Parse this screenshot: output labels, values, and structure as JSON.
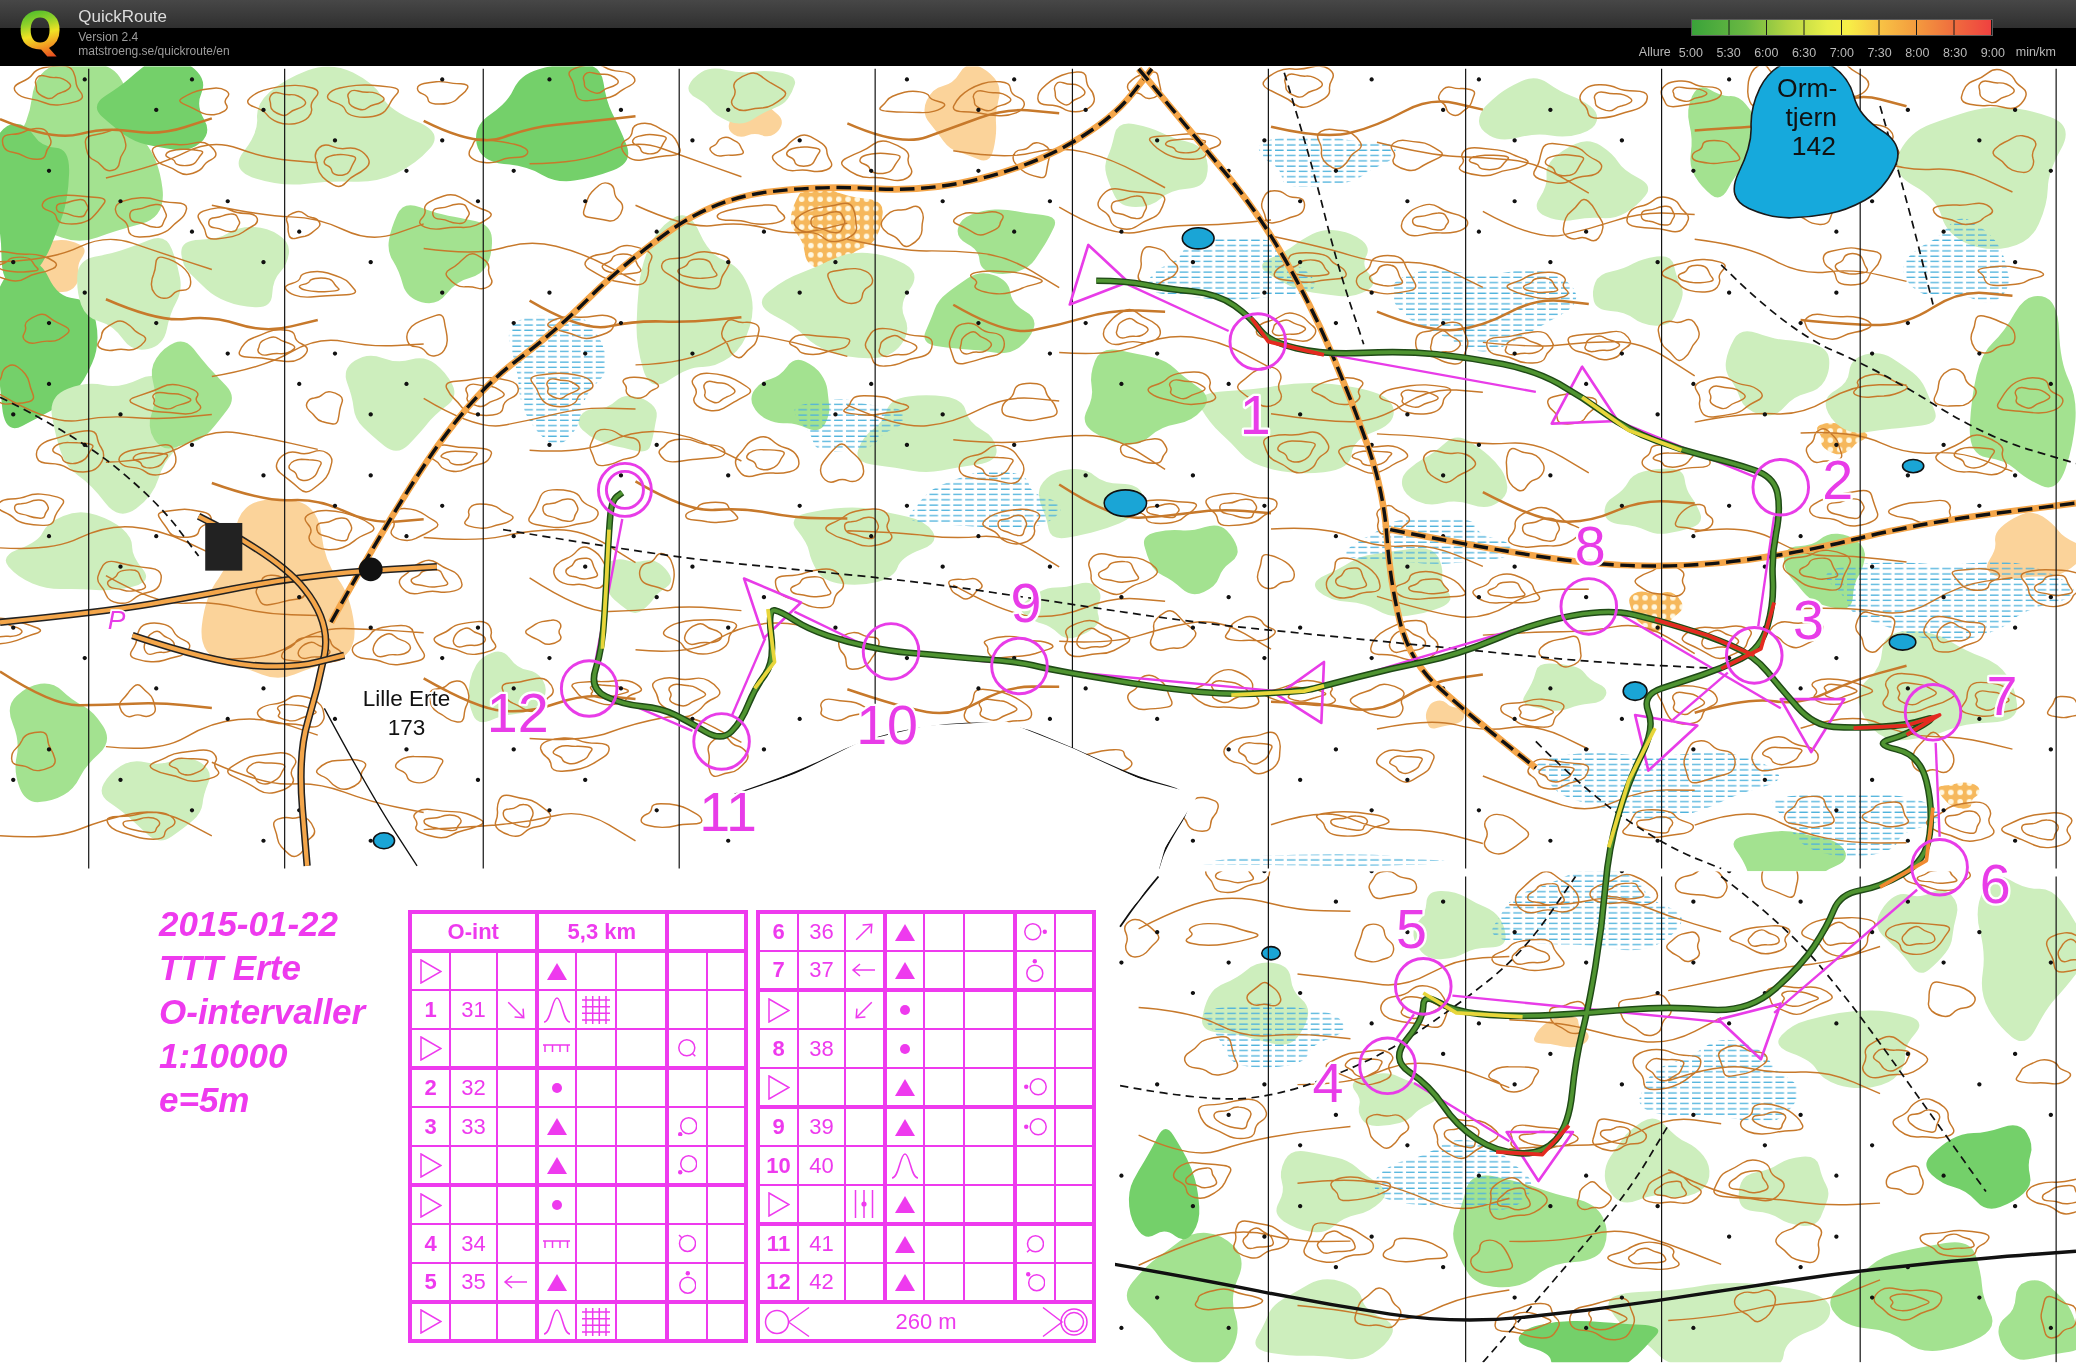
{
  "app": {
    "logo": "Q",
    "title": "QuickRoute",
    "version": "Version 2.4",
    "url": "matstroeng.se/quickroute/en"
  },
  "pace_legend": {
    "label": "Allure",
    "ticks": [
      "5:00",
      "5:30",
      "6:00",
      "6:30",
      "7:00",
      "7:30",
      "8:00",
      "8:30",
      "9:00"
    ],
    "unit": "min/km"
  },
  "map": {
    "place_names": [
      {
        "lines": [
          "Orm-",
          "tjern",
          "142"
        ]
      },
      {
        "lines": [
          "Lille Erte",
          "173"
        ]
      }
    ],
    "parking": "P",
    "controls": [
      {
        "number": "1"
      },
      {
        "number": "2"
      },
      {
        "number": "3"
      },
      {
        "number": "4"
      },
      {
        "number": "5"
      },
      {
        "number": "6"
      },
      {
        "number": "7"
      },
      {
        "number": "8"
      },
      {
        "number": "9"
      },
      {
        "number": "10"
      },
      {
        "number": "11"
      },
      {
        "number": "12"
      }
    ]
  },
  "map_notes": {
    "lines": [
      "2015-01-22",
      "TTT Erte",
      "O-intervaller",
      "1:10000",
      "e=5m"
    ]
  },
  "description_sheet": {
    "tables": [
      {
        "header": {
          "name": "O-int",
          "length": "5,3 km"
        },
        "rows": [
          {
            "cells": [
              {
                "kind": "start"
              },
              {
                "kind": "empty"
              },
              {
                "kind": "empty"
              },
              {
                "kind": "boulder"
              },
              {
                "kind": "empty"
              },
              {
                "kind": "empty"
              },
              {
                "kind": "empty"
              },
              {
                "kind": "empty"
              }
            ]
          },
          {
            "cells": [
              {
                "kind": "number",
                "text": "1"
              },
              {
                "kind": "code",
                "text": "31"
              },
              {
                "kind": "se_arrow"
              },
              {
                "kind": "knoll"
              },
              {
                "kind": "overgrown"
              },
              {
                "kind": "empty"
              },
              {
                "kind": "empty"
              },
              {
                "kind": "empty"
              }
            ]
          },
          {
            "cells": [
              {
                "kind": "start"
              },
              {
                "kind": "empty"
              },
              {
                "kind": "empty"
              },
              {
                "kind": "earth_bank"
              },
              {
                "kind": "empty"
              },
              {
                "kind": "empty"
              },
              {
                "kind": "se_foot"
              },
              {
                "kind": "empty"
              }
            ]
          },
          {
            "cells": [
              {
                "kind": "number",
                "text": "2"
              },
              {
                "kind": "code",
                "text": "32"
              },
              {
                "kind": "empty"
              },
              {
                "kind": "small_knoll"
              },
              {
                "kind": "empty"
              },
              {
                "kind": "empty"
              },
              {
                "kind": "empty"
              },
              {
                "kind": "empty"
              }
            ]
          },
          {
            "cells": [
              {
                "kind": "number",
                "text": "3"
              },
              {
                "kind": "code",
                "text": "33"
              },
              {
                "kind": "empty"
              },
              {
                "kind": "boulder"
              },
              {
                "kind": "empty"
              },
              {
                "kind": "empty"
              },
              {
                "kind": "sw_side"
              },
              {
                "kind": "empty"
              }
            ]
          },
          {
            "cells": [
              {
                "kind": "start"
              },
              {
                "kind": "empty"
              },
              {
                "kind": "empty"
              },
              {
                "kind": "boulder"
              },
              {
                "kind": "empty"
              },
              {
                "kind": "empty"
              },
              {
                "kind": "sw_side"
              },
              {
                "kind": "empty"
              }
            ]
          },
          {
            "cells": [
              {
                "kind": "start"
              },
              {
                "kind": "empty"
              },
              {
                "kind": "empty"
              },
              {
                "kind": "small_knoll"
              },
              {
                "kind": "empty"
              },
              {
                "kind": "empty"
              },
              {
                "kind": "empty"
              },
              {
                "kind": "empty"
              }
            ]
          },
          {
            "cells": [
              {
                "kind": "number",
                "text": "4"
              },
              {
                "kind": "code",
                "text": "34"
              },
              {
                "kind": "empty"
              },
              {
                "kind": "earth_bank"
              },
              {
                "kind": "empty"
              },
              {
                "kind": "empty"
              },
              {
                "kind": "nw_foot"
              },
              {
                "kind": "empty"
              }
            ]
          },
          {
            "cells": [
              {
                "kind": "number",
                "text": "5"
              },
              {
                "kind": "code",
                "text": "35"
              },
              {
                "kind": "w_arrow"
              },
              {
                "kind": "boulder"
              },
              {
                "kind": "empty"
              },
              {
                "kind": "empty"
              },
              {
                "kind": "n_side"
              },
              {
                "kind": "empty"
              }
            ]
          },
          {
            "cells": [
              {
                "kind": "start"
              },
              {
                "kind": "empty"
              },
              {
                "kind": "empty"
              },
              {
                "kind": "knoll"
              },
              {
                "kind": "overgrown"
              },
              {
                "kind": "empty"
              },
              {
                "kind": "empty"
              },
              {
                "kind": "empty"
              }
            ]
          }
        ]
      },
      {
        "rows": [
          {
            "cells": [
              {
                "kind": "number",
                "text": "6"
              },
              {
                "kind": "code",
                "text": "36"
              },
              {
                "kind": "ne_arrow"
              },
              {
                "kind": "boulder"
              },
              {
                "kind": "empty"
              },
              {
                "kind": "empty"
              },
              {
                "kind": "e_side"
              },
              {
                "kind": "empty"
              }
            ]
          },
          {
            "cells": [
              {
                "kind": "number",
                "text": "7"
              },
              {
                "kind": "code",
                "text": "37"
              },
              {
                "kind": "w_arrow"
              },
              {
                "kind": "boulder"
              },
              {
                "kind": "empty"
              },
              {
                "kind": "empty"
              },
              {
                "kind": "n_side"
              },
              {
                "kind": "empty"
              }
            ]
          },
          {
            "cells": [
              {
                "kind": "start"
              },
              {
                "kind": "empty"
              },
              {
                "kind": "sw_arrow"
              },
              {
                "kind": "small_knoll"
              },
              {
                "kind": "empty"
              },
              {
                "kind": "empty"
              },
              {
                "kind": "empty"
              },
              {
                "kind": "empty"
              }
            ]
          },
          {
            "cells": [
              {
                "kind": "number",
                "text": "8"
              },
              {
                "kind": "code",
                "text": "38"
              },
              {
                "kind": "empty"
              },
              {
                "kind": "small_knoll"
              },
              {
                "kind": "empty"
              },
              {
                "kind": "empty"
              },
              {
                "kind": "empty"
              },
              {
                "kind": "empty"
              }
            ]
          },
          {
            "cells": [
              {
                "kind": "start"
              },
              {
                "kind": "empty"
              },
              {
                "kind": "empty"
              },
              {
                "kind": "boulder"
              },
              {
                "kind": "empty"
              },
              {
                "kind": "empty"
              },
              {
                "kind": "w_side"
              },
              {
                "kind": "empty"
              }
            ]
          },
          {
            "cells": [
              {
                "kind": "number",
                "text": "9"
              },
              {
                "kind": "code",
                "text": "39"
              },
              {
                "kind": "empty"
              },
              {
                "kind": "boulder"
              },
              {
                "kind": "empty"
              },
              {
                "kind": "empty"
              },
              {
                "kind": "w_side"
              },
              {
                "kind": "empty"
              }
            ]
          },
          {
            "cells": [
              {
                "kind": "number",
                "text": "10"
              },
              {
                "kind": "code",
                "text": "40"
              },
              {
                "kind": "empty"
              },
              {
                "kind": "knoll"
              },
              {
                "kind": "empty"
              },
              {
                "kind": "empty"
              },
              {
                "kind": "empty"
              },
              {
                "kind": "empty"
              }
            ]
          },
          {
            "cells": [
              {
                "kind": "start"
              },
              {
                "kind": "empty"
              },
              {
                "kind": "between"
              },
              {
                "kind": "boulder"
              },
              {
                "kind": "empty"
              },
              {
                "kind": "empty"
              },
              {
                "kind": "empty"
              },
              {
                "kind": "empty"
              }
            ]
          },
          {
            "cells": [
              {
                "kind": "number",
                "text": "11"
              },
              {
                "kind": "code",
                "text": "41"
              },
              {
                "kind": "empty"
              },
              {
                "kind": "boulder"
              },
              {
                "kind": "empty"
              },
              {
                "kind": "empty"
              },
              {
                "kind": "sw_foot"
              },
              {
                "kind": "empty"
              }
            ]
          },
          {
            "cells": [
              {
                "kind": "number",
                "text": "12"
              },
              {
                "kind": "code",
                "text": "42"
              },
              {
                "kind": "empty"
              },
              {
                "kind": "boulder"
              },
              {
                "kind": "empty"
              },
              {
                "kind": "empty"
              },
              {
                "kind": "nw_side"
              },
              {
                "kind": "empty"
              }
            ]
          }
        ],
        "footer": {
          "distance": "260 m"
        }
      }
    ]
  }
}
